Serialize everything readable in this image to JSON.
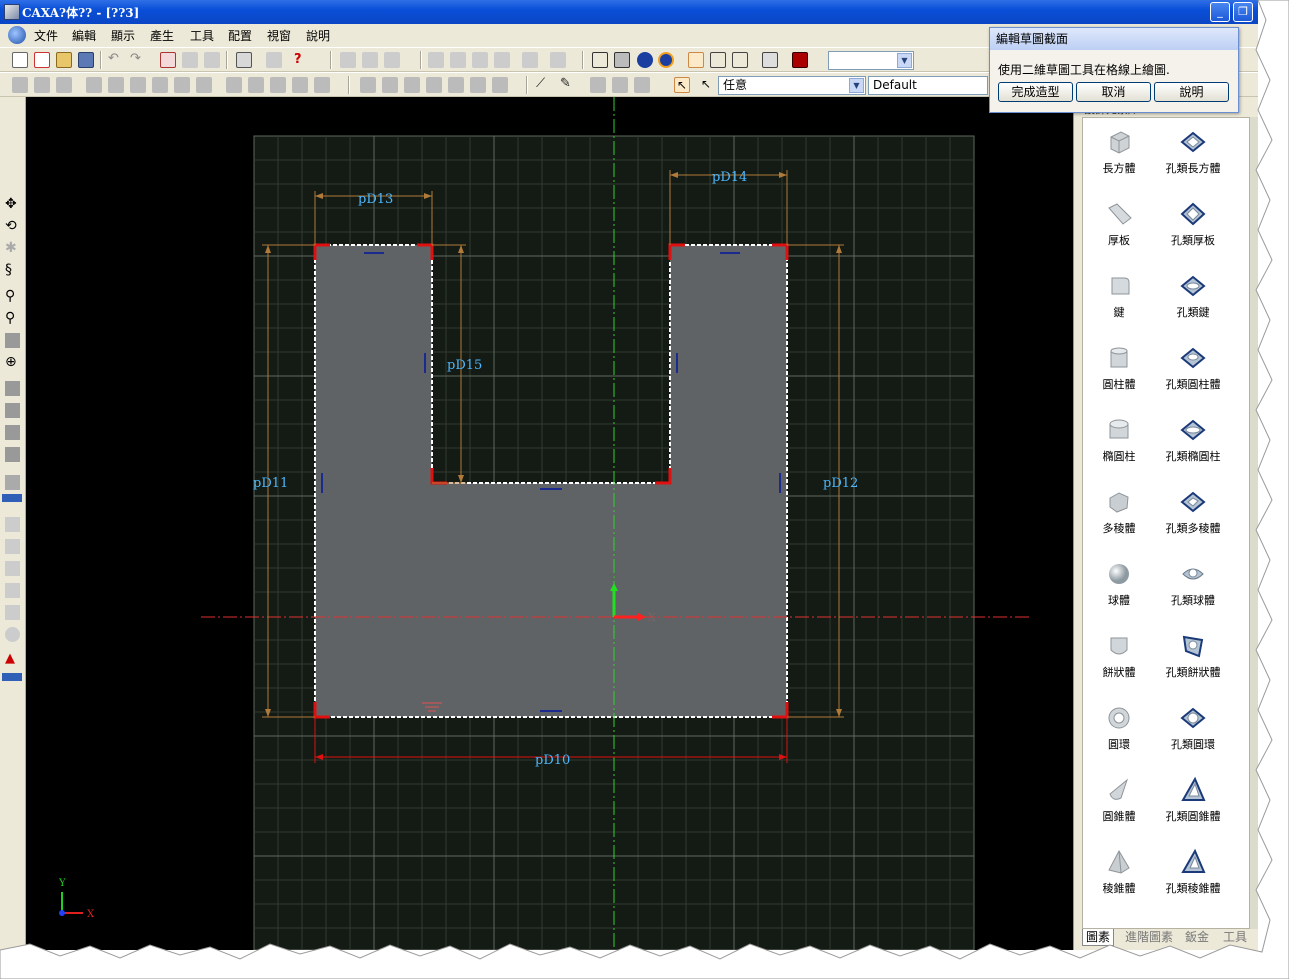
{
  "window": {
    "title": "CAXA?体?? - [??3]"
  },
  "menu": [
    "文件",
    "編輯",
    "顯示",
    "產生",
    "工具",
    "配置",
    "視窗",
    "說明"
  ],
  "toolbar": {
    "filter_value": "任意",
    "style_value": "Default"
  },
  "dialog": {
    "title": "編輯草圖截面",
    "message": "使用二維草圖工具在格線上繪圖.",
    "buttons": [
      "完成造型",
      "取消",
      "說明"
    ]
  },
  "panel": {
    "header": "設計元素庫",
    "items": [
      [
        "長方體",
        "孔類長方體"
      ],
      [
        "厚板",
        "孔類厚板"
      ],
      [
        "鍵",
        "孔類鍵"
      ],
      [
        "圓柱體",
        "孔類圓柱體"
      ],
      [
        "橢圓柱",
        "孔類橢圓柱"
      ],
      [
        "多稜體",
        "孔類多稜體"
      ],
      [
        "球體",
        "孔類球體"
      ],
      [
        "餅狀體",
        "孔類餅狀體"
      ],
      [
        "圓環",
        "孔類圓環"
      ],
      [
        "圓錐體",
        "孔類圓錐體"
      ],
      [
        "稜錐體",
        "孔類稜錐體"
      ]
    ],
    "tabs": [
      "圖素",
      "進階圖素",
      "鈑金",
      "工具"
    ]
  },
  "sketch": {
    "dimensions": {
      "d10": "pD10",
      "d11": "pD11",
      "d12": "pD12",
      "d13": "pD13",
      "d14": "pD14",
      "d15": "pD15"
    },
    "axis_x": "X",
    "axis_y": "Y"
  },
  "colors": {
    "viewport_bg": "#000000",
    "grid": "#2f3a2e",
    "profile_fill": "#5f6366",
    "dimension": "#b07a3a",
    "dim_text": "#4db8ff",
    "axis_x": "#e03030",
    "axis_y": "#30d030"
  }
}
